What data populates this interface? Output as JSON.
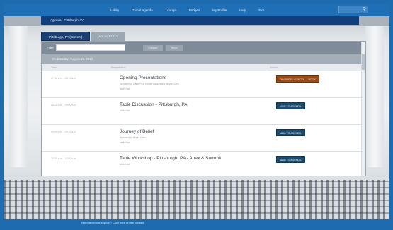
{
  "topnav": {
    "items": [
      "Lobby",
      "Global Agenda",
      "Lounge",
      "Badges",
      "My Profile",
      "Help",
      "Exit"
    ]
  },
  "agenda": {
    "title": "Agenda - Pittsburgh, PA",
    "tabs": [
      {
        "label": "Pittsburgh, PA (Current)",
        "active": true
      },
      {
        "label": "MY AGENDA",
        "active": false
      }
    ],
    "filter_label": "Filter",
    "filter_placeholder": "",
    "buttons": [
      "Collapse",
      "Reset"
    ],
    "day_header": "Wednesday, August 12, 2015",
    "columns": [
      "Time",
      "Presentation",
      "Actions"
    ],
    "sessions": [
      {
        "time": "07:30 a.m. - 08:15 a.m.",
        "title": "Opening Presentations",
        "speakers": "Speaker(s): Dave Fox, Nicole Lamoreaux, Bryan Glen",
        "track": "Main Hall",
        "action": "FAVORITE / CANCEL — BOOK",
        "action_style": "orange"
      },
      {
        "time": "08:15 a.m. - 09:00 a.m.",
        "title": "Table Discussion - Pittsburgh, PA",
        "speakers": "",
        "track": "Main Hall",
        "action": "ADD TO AGENDA",
        "action_style": "blue"
      },
      {
        "time": "09:00 a.m. - 09:45 a.m.",
        "title": "Journey of Belief",
        "speakers": "Speaker(s): Bryan Glen",
        "track": "Main Hall",
        "action": "ADD TO AGENDA",
        "action_style": "blue"
      },
      {
        "time": "10:00 a.m. - 12:00 p.m.",
        "title": "Table Workshop - Pittsburgh, PA - Apex & Summit",
        "speakers": "",
        "track": "Main Hall",
        "action": "ADD TO AGENDA",
        "action_style": "blue"
      }
    ]
  },
  "footer": {
    "caption": "Need technical support? Click here on the contact"
  },
  "colors": {
    "nav_bg": "#1f6fb6",
    "agenda_bar": "#123f7c",
    "orange_button": "#9c4a14",
    "blue_button": "#1d4b6e"
  }
}
